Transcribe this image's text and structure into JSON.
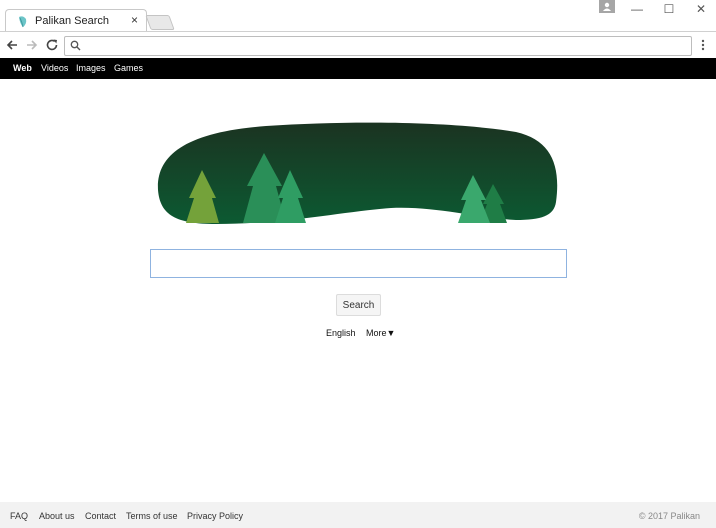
{
  "browser": {
    "tab_title": "Palikan Search",
    "tab_close": "×",
    "address_value": "",
    "window_minimize": "—",
    "window_maximize": "☐",
    "window_close": "✕"
  },
  "nav": {
    "items": [
      {
        "label": "Web",
        "active": true
      },
      {
        "label": "Videos",
        "active": false
      },
      {
        "label": "Images",
        "active": false
      },
      {
        "label": "Games",
        "active": false
      }
    ]
  },
  "search": {
    "query": "",
    "button_label": "Search"
  },
  "language": {
    "current": "English",
    "more_label": "More▼"
  },
  "footer": {
    "links": [
      "FAQ",
      "About us",
      "Contact",
      "Terms of use",
      "Privacy Policy"
    ],
    "copyright": "© 2017 Palikan"
  },
  "colors": {
    "nav_bg": "#000000",
    "hero_dark": "#173a23",
    "hero_mid": "#0f5a34",
    "tree_light": "#7aa33d",
    "tree_green": "#2f9d63",
    "footer_bg": "#f2f2f2",
    "search_border": "#8fb3e0"
  },
  "icons": {
    "favicon": "palikan-leaf-icon",
    "back": "arrow-left-icon",
    "forward": "arrow-right-icon",
    "reload": "reload-icon",
    "omnibox_search": "search-icon",
    "menu": "vertical-dots-icon",
    "profile": "profile-icon"
  }
}
